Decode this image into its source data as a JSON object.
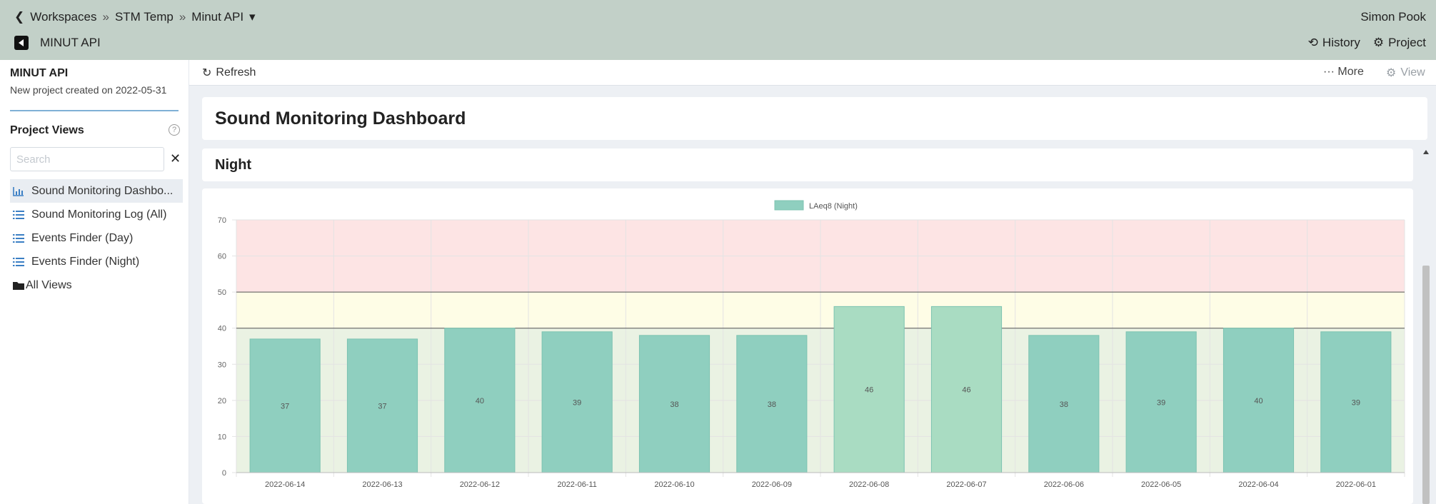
{
  "breadcrumb": {
    "items": [
      "Workspaces",
      "STM Temp",
      "Minut API"
    ],
    "separator": "»"
  },
  "user": {
    "name": "Simon Pook"
  },
  "project": {
    "name": "MINUT API"
  },
  "top_actions": {
    "history": "History",
    "project": "Project"
  },
  "sidebar": {
    "title": "MINUT API",
    "subtitle": "New project created on 2022-05-31",
    "views_heading": "Project Views",
    "help": "?",
    "search_placeholder": "Search",
    "clear": "✕",
    "items": [
      {
        "label": "Sound Monitoring Dashbo...",
        "icon": "bar-chart-icon",
        "active": true
      },
      {
        "label": "Sound Monitoring Log (All)",
        "icon": "list-icon",
        "active": false
      },
      {
        "label": "Events Finder (Day)",
        "icon": "list-icon",
        "active": false
      },
      {
        "label": "Events Finder (Night)",
        "icon": "list-icon",
        "active": false
      },
      {
        "label": "All Views",
        "icon": "folder-icon",
        "active": false
      }
    ]
  },
  "toolbar": {
    "refresh": "Refresh",
    "more": "··· More",
    "view": "View"
  },
  "dashboard": {
    "title": "Sound Monitoring Dashboard",
    "section": "Night"
  },
  "chart_data": {
    "type": "bar",
    "series": [
      {
        "name": "LAeq8 (Night)",
        "values": [
          37,
          37,
          40,
          39,
          38,
          38,
          46,
          46,
          38,
          39,
          40,
          39
        ]
      }
    ],
    "categories": [
      "2022-06-14",
      "2022-06-13",
      "2022-06-12",
      "2022-06-11",
      "2022-06-10",
      "2022-06-09",
      "2022-06-08",
      "2022-06-07",
      "2022-06-06",
      "2022-06-05",
      "2022-06-04",
      "2022-06-01"
    ],
    "ylim": [
      0,
      70
    ],
    "yticks": [
      0,
      10,
      20,
      30,
      40,
      50,
      60,
      70
    ],
    "thresholds": [
      40,
      50
    ],
    "bands": [
      {
        "from": 0,
        "to": 40,
        "color": "#eaf2e3"
      },
      {
        "from": 40,
        "to": 50,
        "color": "#fefde6"
      },
      {
        "from": 50,
        "to": 70,
        "color": "#fde4e4"
      }
    ],
    "bar_color": "#8fcfbf",
    "bar_color_over": "#a9dcc2",
    "legend": "top",
    "grid": true
  }
}
